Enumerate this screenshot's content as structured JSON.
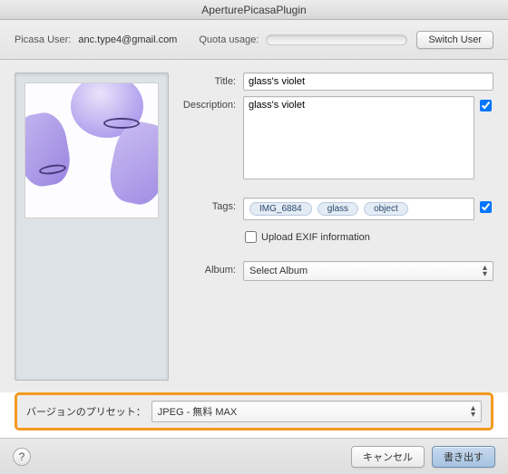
{
  "window": {
    "title": "AperturePicasaPlugin"
  },
  "header": {
    "user_label": "Picasa User:",
    "user_email": "anc.type4@gmail.com",
    "quota_label": "Quota usage:",
    "switch_user_btn": "Switch User"
  },
  "form": {
    "title_label": "Title:",
    "title_value": "glass's violet",
    "description_label": "Description:",
    "description_value": "glass's violet",
    "tags_label": "Tags:",
    "tags": [
      "IMG_6884",
      "glass",
      "object"
    ],
    "upload_exif_label": "Upload EXIF information",
    "album_label": "Album:",
    "album_selected": "Select Album"
  },
  "preset": {
    "label": "バージョンのプリセット：",
    "selected": "JPEG - 無料 MAX"
  },
  "footer": {
    "help": "?",
    "cancel": "キャンセル",
    "export": "書き出す"
  }
}
